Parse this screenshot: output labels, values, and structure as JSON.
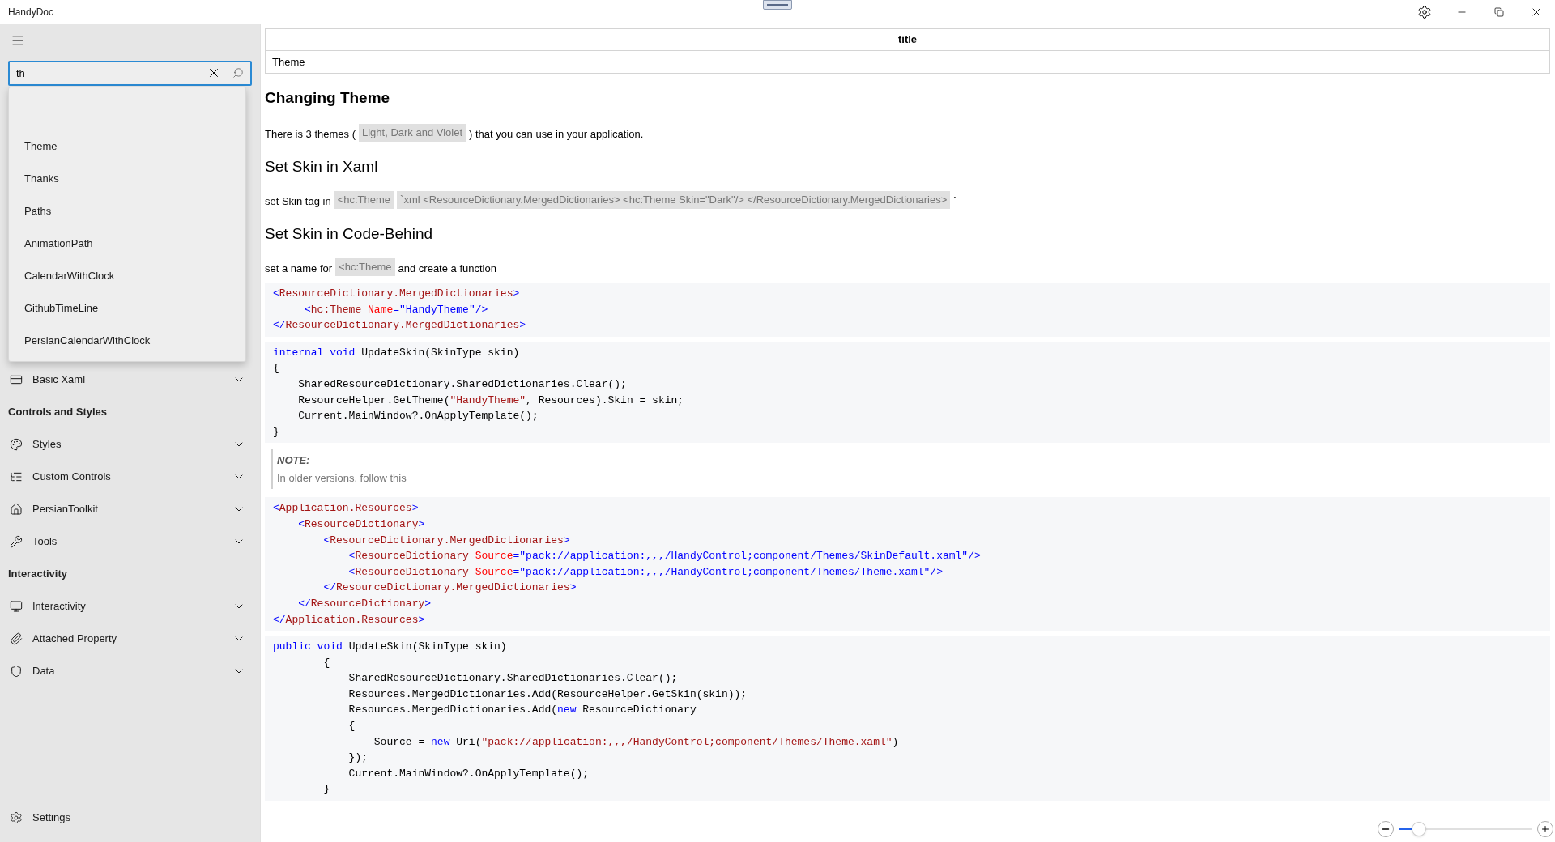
{
  "window": {
    "title": "HandyDoc"
  },
  "sidebar": {
    "search": {
      "value": "th"
    },
    "suggestions": [
      "Theme",
      "Thanks",
      "Paths",
      "AnimationPath",
      "CalendarWithClock",
      "GithubTimeLine",
      "PersianCalendarWithClock"
    ],
    "items": [
      {
        "kind": "item",
        "label": "Basic Xaml",
        "expanded": false
      },
      {
        "kind": "header",
        "label": "Controls and Styles"
      },
      {
        "kind": "item",
        "label": "Styles",
        "expanded": false
      },
      {
        "kind": "item",
        "label": "Custom Controls",
        "expanded": false
      },
      {
        "kind": "item",
        "label": "PersianToolkit",
        "expanded": false
      },
      {
        "kind": "item",
        "label": "Tools",
        "expanded": false
      },
      {
        "kind": "header",
        "label": "Interactivity"
      },
      {
        "kind": "item",
        "label": "Interactivity",
        "expanded": false
      },
      {
        "kind": "item",
        "label": "Attached Property",
        "expanded": false
      },
      {
        "kind": "item",
        "label": "Data",
        "expanded": false
      }
    ],
    "settings": "Settings"
  },
  "table": {
    "columns": [
      "title"
    ],
    "rows": [
      [
        "Theme"
      ]
    ]
  },
  "content": [
    {
      "kind": "h1",
      "text": "Changing Theme"
    },
    {
      "kind": "p",
      "parts": [
        {
          "kind": "text",
          "text": "There is 3 themes ("
        },
        {
          "kind": "code",
          "text": "Light, Dark and Violet"
        },
        {
          "kind": "text",
          "text": ") that you can use in your application."
        }
      ]
    },
    {
      "kind": "h2",
      "text": "Set Skin in Xaml"
    },
    {
      "kind": "p",
      "parts": [
        {
          "kind": "text",
          "text": "set Skin tag in"
        },
        {
          "kind": "code",
          "text": "<hc:Theme"
        },
        {
          "kind": "code",
          "text": "`xml <ResourceDictionary.MergedDictionaries> <hc:Theme Skin=\"Dark\"/> </ResourceDictionary.MergedDictionaries>"
        },
        {
          "kind": "text",
          "text": "`"
        }
      ]
    },
    {
      "kind": "h2",
      "text": "Set Skin in Code-Behind"
    },
    {
      "kind": "p",
      "parts": [
        {
          "kind": "text",
          "text": "set a name for"
        },
        {
          "kind": "code",
          "text": "<hc:Theme"
        },
        {
          "kind": "text",
          "text": "and create a function"
        }
      ]
    },
    {
      "kind": "code",
      "lines": [
        [
          {
            "punct": "<"
          },
          {
            "tag": "ResourceDictionary.MergedDictionaries"
          },
          {
            "punct": ">"
          }
        ],
        [
          {
            "punct": "     <"
          },
          {
            "tag": "hc:Theme"
          },
          {
            "attr": " Name"
          },
          {
            "punct": "="
          },
          {
            "value": "\"HandyTheme\""
          },
          {
            "punct": "/>"
          }
        ],
        [
          {
            "punct": "</"
          },
          {
            "tag": "ResourceDictionary.MergedDictionaries"
          },
          {
            "punct": ">"
          }
        ]
      ]
    },
    {
      "kind": "code",
      "lines": [
        [
          {
            "keyword": "internal "
          },
          {
            "keyword": "void"
          },
          {
            "plain": " UpdateSkin(SkinType skin)"
          }
        ],
        [
          {
            "plain": "{"
          }
        ],
        [
          {
            "plain": "    SharedResourceDictionary.SharedDictionaries.Clear();"
          }
        ],
        [
          {
            "plain": "    ResourceHelper.GetTheme("
          },
          {
            "string": "\"HandyTheme\""
          },
          {
            "plain": ", Resources).Skin = skin;"
          }
        ],
        [
          {
            "plain": "    Current.MainWindow?.OnApplyTemplate();"
          }
        ],
        [
          {
            "plain": "}"
          }
        ]
      ]
    },
    {
      "kind": "note",
      "title": "NOTE:",
      "text": "In older versions, follow this"
    },
    {
      "kind": "code",
      "lines": [
        [
          {
            "punct": "<"
          },
          {
            "tag": "Application.Resources"
          },
          {
            "punct": ">"
          }
        ],
        [
          {
            "punct": "    <"
          },
          {
            "tag": "ResourceDictionary"
          },
          {
            "punct": ">"
          }
        ],
        [
          {
            "punct": "        <"
          },
          {
            "tag": "ResourceDictionary.MergedDictionaries"
          },
          {
            "punct": ">"
          }
        ],
        [
          {
            "punct": "            <"
          },
          {
            "tag": "ResourceDictionary"
          },
          {
            "attr": " Source"
          },
          {
            "punct": "="
          },
          {
            "value": "\"pack://application:,,,/HandyControl;component/Themes/SkinDefault.xaml\""
          },
          {
            "punct": "/>"
          }
        ],
        [
          {
            "punct": "            <"
          },
          {
            "tag": "ResourceDictionary"
          },
          {
            "attr": " Source"
          },
          {
            "punct": "="
          },
          {
            "value": "\"pack://application:,,,/HandyControl;component/Themes/Theme.xaml\""
          },
          {
            "punct": "/>"
          }
        ],
        [
          {
            "punct": "        </"
          },
          {
            "tag": "ResourceDictionary.MergedDictionaries"
          },
          {
            "punct": ">"
          }
        ],
        [
          {
            "punct": "    </"
          },
          {
            "tag": "ResourceDictionary"
          },
          {
            "punct": ">"
          }
        ],
        [
          {
            "punct": "</"
          },
          {
            "tag": "Application.Resources"
          },
          {
            "punct": ">"
          }
        ]
      ]
    },
    {
      "kind": "code",
      "lines": [
        [
          {
            "keyword": "public "
          },
          {
            "keyword": "void"
          },
          {
            "plain": " UpdateSkin(SkinType skin)"
          }
        ],
        [
          {
            "plain": "        {"
          }
        ],
        [
          {
            "plain": "            SharedResourceDictionary.SharedDictionaries.Clear();"
          }
        ],
        [
          {
            "plain": "            Resources.MergedDictionaries.Add(ResourceHelper.GetSkin(skin));"
          }
        ],
        [
          {
            "plain": "            Resources.MergedDictionaries.Add("
          },
          {
            "keyword": "new"
          },
          {
            "plain": " ResourceDictionary"
          }
        ],
        [
          {
            "plain": "            {"
          }
        ],
        [
          {
            "plain": "                Source = "
          },
          {
            "keyword": "new"
          },
          {
            "plain": " Uri("
          },
          {
            "string": "\"pack://application:,,,/HandyControl;component/Themes/Theme.xaml\""
          },
          {
            "plain": ")"
          }
        ],
        [
          {
            "plain": "            });"
          }
        ],
        [
          {
            "plain": "            Current.MainWindow?.OnApplyTemplate();"
          }
        ],
        [
          {
            "plain": "        }"
          }
        ]
      ]
    }
  ],
  "zoom": {
    "level": 0.15
  }
}
